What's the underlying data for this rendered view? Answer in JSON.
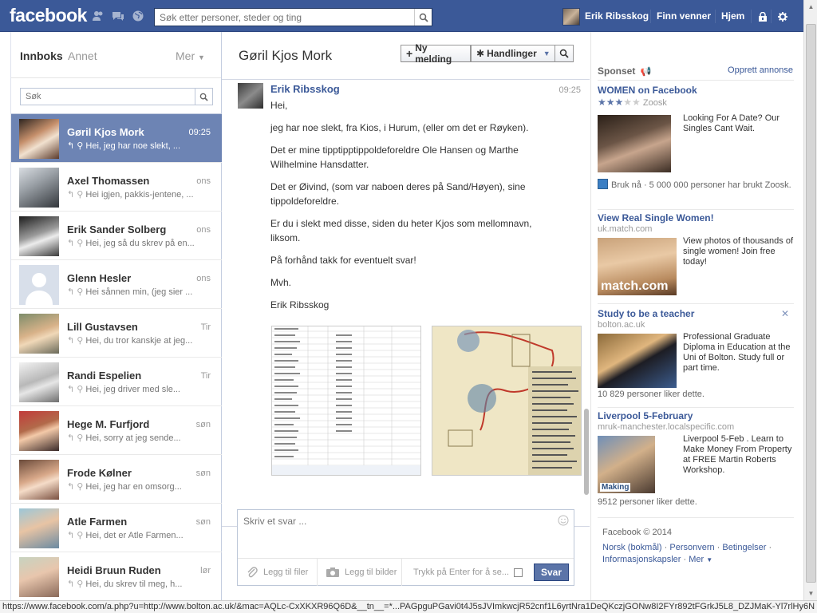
{
  "topbar": {
    "logo": "facebook",
    "search_placeholder": "Søk etter personer, steder og ting",
    "user_name": "Erik Ribsskog",
    "find_friends": "Finn venner",
    "home": "Hjem"
  },
  "left": {
    "tab_inbox": "Innboks",
    "tab_other": "Annet",
    "tab_more": "Mer",
    "search_placeholder": "Søk",
    "threads": [
      {
        "name": "Gøril Kjos Mork",
        "time": "09:25",
        "snippet": "Hei, jeg har noe slekt, ..."
      },
      {
        "name": "Axel Thomassen",
        "time": "ons",
        "snippet": "Hei igjen, pakkis-jentene, ..."
      },
      {
        "name": "Erik Sander Solberg",
        "time": "ons",
        "snippet": "Hei, jeg så du skrev på en..."
      },
      {
        "name": "Glenn Hesler",
        "time": "ons",
        "snippet": "Hei sånnen min, (jeg sier ..."
      },
      {
        "name": "Lill Gustavsen",
        "time": "Tir",
        "snippet": "Hei, du tror kanskje at jeg..."
      },
      {
        "name": "Randi Espelien",
        "time": "Tir",
        "snippet": "Hei, jeg driver med sle..."
      },
      {
        "name": "Hege M. Furfjord",
        "time": "søn",
        "snippet": "Hei, sorry at jeg sende..."
      },
      {
        "name": "Frode Kølner",
        "time": "søn",
        "snippet": "Hei, jeg har en omsorg..."
      },
      {
        "name": "Atle Farmen",
        "time": "søn",
        "snippet": "Hei, det er Atle Farmen..."
      },
      {
        "name": "Heidi Bruun Ruden",
        "time": "lør",
        "snippet": "Hei, du skrev til meg, h..."
      }
    ]
  },
  "conversation": {
    "title": "Gøril Kjos Mork",
    "new_message": "Ny melding",
    "actions": "Handlinger",
    "author": "Erik Ribsskog",
    "time": "09:25",
    "paragraphs": [
      "Hei,",
      "jeg har noe slekt, fra Kios, i Hurum, (eller om det er Røyken).",
      "Det er mine tipptipptippoldeforeldre Ole Hansen og Marthe Wilhelmine Hansdatter.",
      "Det er Øivind, (som var naboen deres på Sand/Høyen), sine tippoldeforeldre.",
      "Er du i slekt med disse, siden du heter Kjos som mellomnavn, liksom.",
      "På forhånd takk for eventuelt svar!",
      "Mvh.",
      "Erik Ribsskog"
    ],
    "reply_placeholder": "Skriv et svar ...",
    "attach_files": "Legg til filer",
    "attach_photos": "Legg til bilder",
    "enter_to_send": "Trykk på Enter for å se...",
    "send": "Svar"
  },
  "sponsored": {
    "title": "Sponset",
    "create_ad": "Opprett annonse",
    "ads": [
      {
        "title": "WOMEN on Facebook",
        "url": "Zoosk",
        "text": "Looking For A Date? Our Singles Cant Wait.",
        "likes": "Bruk nå · 5 000 000 personer har brukt Zoosk.",
        "rating": 3
      },
      {
        "title": "View Real Single Women!",
        "url": "uk.match.com",
        "text": "View photos of thousands of single women! Join free today!",
        "likes": ""
      },
      {
        "title": "Study to be a teacher",
        "url": "bolton.ac.uk",
        "text": "Professional Graduate Diploma in Education at the Uni of Bolton. Study full or part time.",
        "likes": "10 829 personer liker dette."
      },
      {
        "title": "Liverpool 5-February",
        "url": "mruk-manchester.localspecific.com",
        "text": "Liverpool 5-Feb . Learn to Make Money From Property at FREE Martin Roberts Workshop.",
        "likes": "9512 personer liker dette."
      }
    ],
    "match_logo": "match.com",
    "making_logo": "Making"
  },
  "footer": {
    "copyright": "Facebook © 2014",
    "links": [
      "Norsk (bokmål)",
      "Personvern",
      "Betingelser",
      "Informasjonskapsler",
      "Mer"
    ]
  },
  "statusbar": {
    "url": "https://www.facebook.com/a.php?u=http://www.bolton.ac.uk/&mac=AQLc-CxXKXR96Q6D&__tn__=*...PAGpguPGavi0t4J5sJVImkwcjR52cnf1L6yrtNra1DeQKczjGONw8I2FYr892tFGrkJ5L8_DZJMaK-Yl7rlHy6N"
  },
  "colors": {
    "brand": "#3b5998",
    "active_thread": "#6d84b4",
    "send_button": "#5b74a8"
  }
}
